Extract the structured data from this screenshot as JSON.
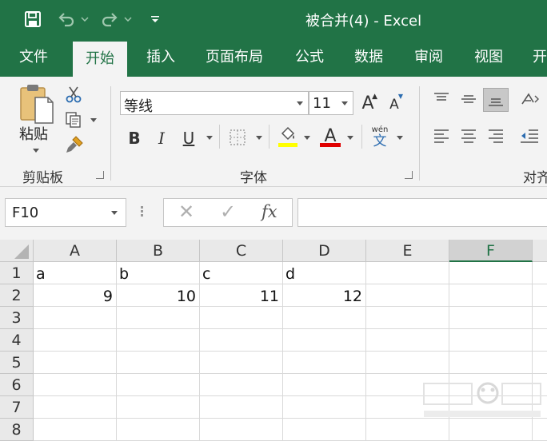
{
  "window": {
    "title": "被合并(4)  -  Excel"
  },
  "qat": {
    "save_icon": "save-icon",
    "undo_icon": "undo-icon",
    "redo_icon": "redo-icon",
    "customize_icon": "customize-qat-icon"
  },
  "tabs": [
    {
      "label": "文件"
    },
    {
      "label": "开始"
    },
    {
      "label": "插入"
    },
    {
      "label": "页面布局"
    },
    {
      "label": "公式"
    },
    {
      "label": "数据"
    },
    {
      "label": "审阅"
    },
    {
      "label": "视图"
    },
    {
      "label": "开"
    }
  ],
  "active_tab": "开始",
  "ribbon": {
    "clipboard": {
      "paste_label": "粘贴",
      "group_label": "剪贴板"
    },
    "font": {
      "font_name": "等线",
      "font_size": "11",
      "grow_label": "A",
      "shrink_label": "A",
      "bold_label": "B",
      "italic_label": "I",
      "underline_label": "U",
      "font_color_label": "A",
      "phonetic_top": "wén",
      "phonetic_bottom": "文",
      "group_label": "字体",
      "highlight_color": "#ffff00",
      "font_color": "#e00000"
    },
    "alignment": {
      "group_label": "对齐"
    }
  },
  "formula_bar": {
    "name_box": "F10",
    "cancel_label": "✕",
    "enter_label": "✓",
    "fx_label": "fx",
    "formula": ""
  },
  "grid": {
    "columns": [
      "A",
      "B",
      "C",
      "D",
      "E",
      "F"
    ],
    "selected_column": "F",
    "rows": [
      "1",
      "2",
      "3",
      "4",
      "5",
      "6",
      "7",
      "8"
    ],
    "cells": {
      "A1": "a",
      "B1": "b",
      "C1": "c",
      "D1": "d",
      "A2": "9",
      "B2": "10",
      "C2": "11",
      "D2": "12"
    }
  },
  "colors": {
    "excel_green": "#217346",
    "ribbon_bg": "#f3f3f3"
  }
}
